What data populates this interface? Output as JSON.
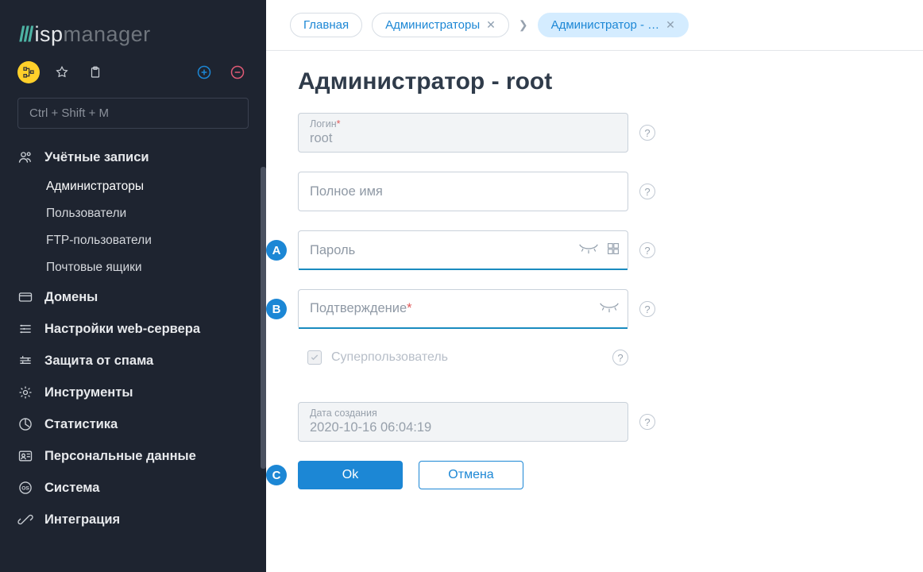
{
  "logo": {
    "slashes": "///",
    "light": "isp",
    "dim": "manager"
  },
  "sidebar": {
    "search_placeholder": "Ctrl + Shift + M",
    "accounts_label": "Учётные записи",
    "accounts_items": [
      "Администраторы",
      "Пользователи",
      "FTP-пользователи",
      "Почтовые ящики"
    ],
    "menu": [
      "Домены",
      "Настройки web-сервера",
      "Защита от спама",
      "Инструменты",
      "Статистика",
      "Персональные данные",
      "Система",
      "Интеграция"
    ]
  },
  "breadcrumbs": {
    "home": "Главная",
    "admins": "Администраторы",
    "current": "Администратор - …"
  },
  "page": {
    "title": "Администратор - root",
    "login_label": "Логин",
    "login_value": "root",
    "fullname_placeholder": "Полное имя",
    "password_placeholder": "Пароль",
    "confirm_placeholder": "Подтверждение",
    "superuser_label": "Суперпользователь",
    "created_label": "Дата создания",
    "created_value": "2020-10-16 06:04:19",
    "ok": "Ok",
    "cancel": "Отмена"
  },
  "badges": {
    "a": "A",
    "b": "B",
    "c": "C"
  },
  "required_mark": "*"
}
